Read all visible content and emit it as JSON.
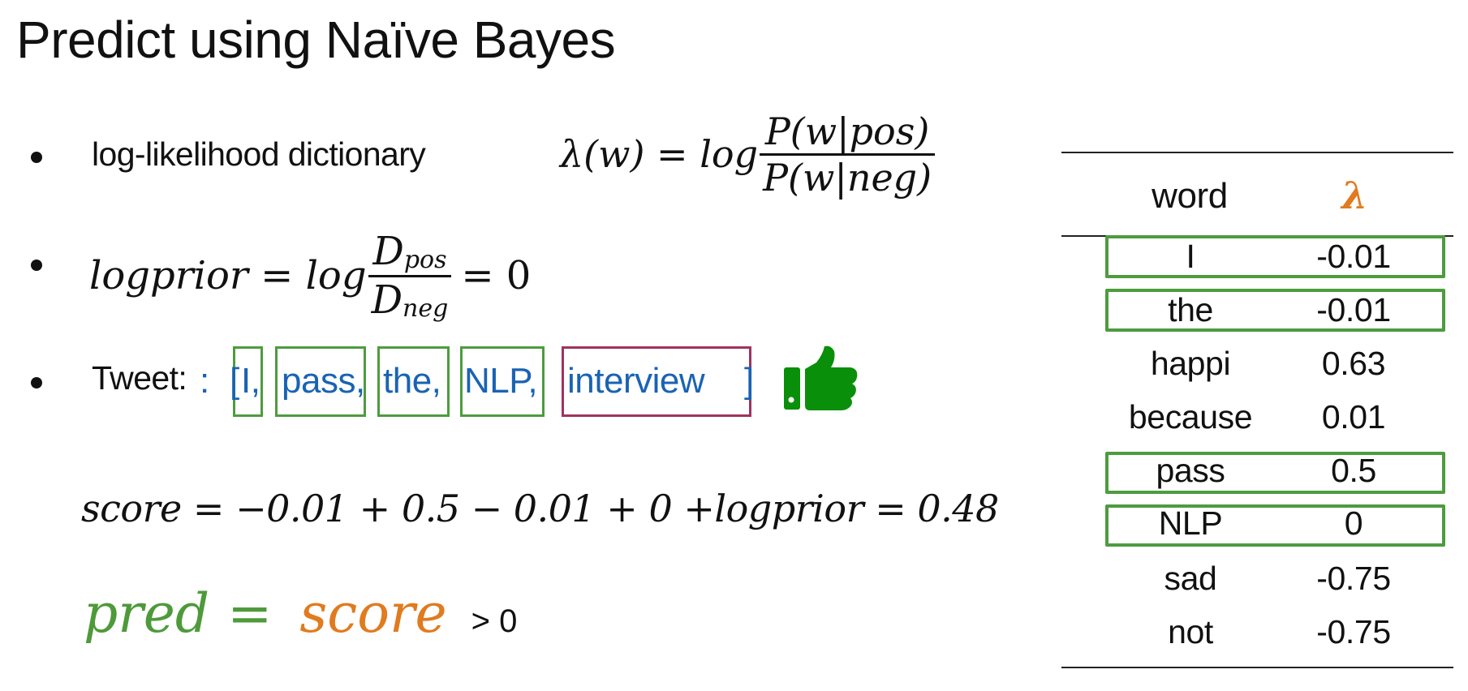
{
  "slide": {
    "title": "Predict using Naïve Bayes",
    "bullets": {
      "loglikelihood": {
        "label": "log-likelihood dictionary",
        "lhs": "λ(w) = log",
        "numerator": "P(w|pos)",
        "denominator": "P(w|neg)"
      },
      "logprior": {
        "lhs": "logprior = log",
        "numerator_base": "D",
        "numerator_sub": "pos",
        "denominator_base": "D",
        "denominator_sub": "neg",
        "rhs": "= 0"
      },
      "tweet": {
        "label": "Tweet:",
        "open_bracket": "[",
        "close_bracket": "]",
        "tokens": [
          {
            "text": "I",
            "sep": ",",
            "in_dictionary": true
          },
          {
            "text": "pass",
            "sep": ",",
            "in_dictionary": true
          },
          {
            "text": "the",
            "sep": ",",
            "in_dictionary": true
          },
          {
            "text": "NLP",
            "sep": ",",
            "in_dictionary": true
          },
          {
            "text": "interview",
            "sep": "",
            "in_dictionary": false
          }
        ],
        "sentiment_icon": "thumbs-up-icon"
      }
    },
    "score_equation": "score = −0.01 + 0.5 − 0.01 + 0 +logprior = 0.48",
    "prediction": {
      "lhs": "pred",
      "equals": "=",
      "rhs": "score",
      "condition": "> 0"
    },
    "colors": {
      "token_text": "#1a63b3",
      "match_box": "#4d9c3e",
      "miss_box": "#a0335f",
      "lambda_header": "#e07b1f",
      "pred_green": "#4e9a3a",
      "score_orange": "#e07b1f",
      "thumb": "#0a8f0a"
    }
  },
  "table": {
    "headers": {
      "word": "word",
      "lambda": "λ"
    },
    "rows": [
      {
        "word": "I",
        "lambda": "-0.01",
        "highlighted": true
      },
      {
        "word": "the",
        "lambda": "-0.01",
        "highlighted": true
      },
      {
        "word": "happi",
        "lambda": "0.63",
        "highlighted": false
      },
      {
        "word": "because",
        "lambda": "0.01",
        "highlighted": false
      },
      {
        "word": "pass",
        "lambda": "0.5",
        "highlighted": true
      },
      {
        "word": "NLP",
        "lambda": "0",
        "highlighted": true
      },
      {
        "word": "sad",
        "lambda": "-0.75",
        "highlighted": false
      },
      {
        "word": "not",
        "lambda": "-0.75",
        "highlighted": false
      }
    ]
  }
}
